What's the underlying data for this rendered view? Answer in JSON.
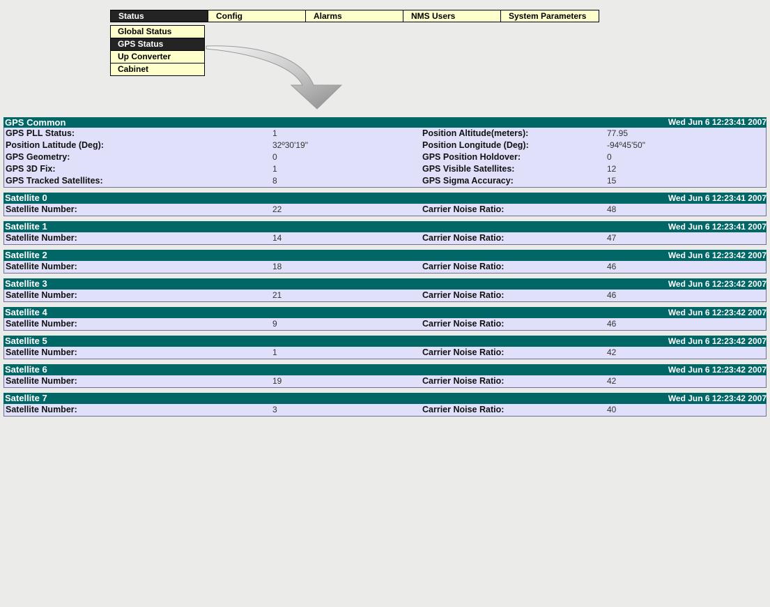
{
  "menu": {
    "tabs": [
      {
        "label": "Status",
        "active": true
      },
      {
        "label": "Config",
        "active": false
      },
      {
        "label": "Alarms",
        "active": false
      },
      {
        "label": "NMS Users",
        "active": false
      },
      {
        "label": "System Parameters",
        "active": false
      }
    ],
    "submenu": [
      {
        "label": "Global Status",
        "active": false
      },
      {
        "label": "GPS Status",
        "active": true
      },
      {
        "label": "Up Converter",
        "active": false
      },
      {
        "label": "Cabinet",
        "active": false
      }
    ]
  },
  "gps_common": {
    "title": "GPS Common",
    "timestamp": "Wed Jun 6 12:23:41 2007",
    "rows": [
      {
        "label1": "GPS PLL Status:",
        "value1": "1",
        "label2": "Position Altitude(meters):",
        "value2": "77.95"
      },
      {
        "label1": "Position Latitude (Deg):",
        "value1": "32º30'19\"",
        "label2": "Position Longitude (Deg):",
        "value2": "-94º45'50\""
      },
      {
        "label1": "GPS Geometry:",
        "value1": "0",
        "label2": "GPS Position Holdover:",
        "value2": "0"
      },
      {
        "label1": "GPS 3D Fix:",
        "value1": "1",
        "label2": "GPS Visible Satellites:",
        "value2": "12"
      },
      {
        "label1": "GPS Tracked Satellites:",
        "value1": "8",
        "label2": "GPS Sigma Accuracy:",
        "value2": "15"
      }
    ]
  },
  "satellites": [
    {
      "title": "Satellite 0",
      "timestamp": "Wed Jun 6 12:23:41 2007",
      "number_label": "Satellite Number:",
      "number": "22",
      "cnr_label": "Carrier Noise Ratio:",
      "cnr": "48"
    },
    {
      "title": "Satellite 1",
      "timestamp": "Wed Jun 6 12:23:41 2007",
      "number_label": "Satellite Number:",
      "number": "14",
      "cnr_label": "Carrier Noise Ratio:",
      "cnr": "47"
    },
    {
      "title": "Satellite 2",
      "timestamp": "Wed Jun 6 12:23:42 2007",
      "number_label": "Satellite Number:",
      "number": "18",
      "cnr_label": "Carrier Noise Ratio:",
      "cnr": "46"
    },
    {
      "title": "Satellite 3",
      "timestamp": "Wed Jun 6 12:23:42 2007",
      "number_label": "Satellite Number:",
      "number": "21",
      "cnr_label": "Carrier Noise Ratio:",
      "cnr": "46"
    },
    {
      "title": "Satellite 4",
      "timestamp": "Wed Jun 6 12:23:42 2007",
      "number_label": "Satellite Number:",
      "number": "9",
      "cnr_label": "Carrier Noise Ratio:",
      "cnr": "46"
    },
    {
      "title": "Satellite 5",
      "timestamp": "Wed Jun 6 12:23:42 2007",
      "number_label": "Satellite Number:",
      "number": "1",
      "cnr_label": "Carrier Noise Ratio:",
      "cnr": "42"
    },
    {
      "title": "Satellite 6",
      "timestamp": "Wed Jun 6 12:23:42 2007",
      "number_label": "Satellite Number:",
      "number": "19",
      "cnr_label": "Carrier Noise Ratio:",
      "cnr": "42"
    },
    {
      "title": "Satellite 7",
      "timestamp": "Wed Jun 6 12:23:42 2007",
      "number_label": "Satellite Number:",
      "number": "3",
      "cnr_label": "Carrier Noise Ratio:",
      "cnr": "40"
    }
  ],
  "colors": {
    "header_bg": "#006666",
    "panel_bg": "#e0e0fa",
    "menu_bg": "#ffffcc",
    "menu_active_bg": "#242424",
    "page_bg": "#ebebea"
  }
}
